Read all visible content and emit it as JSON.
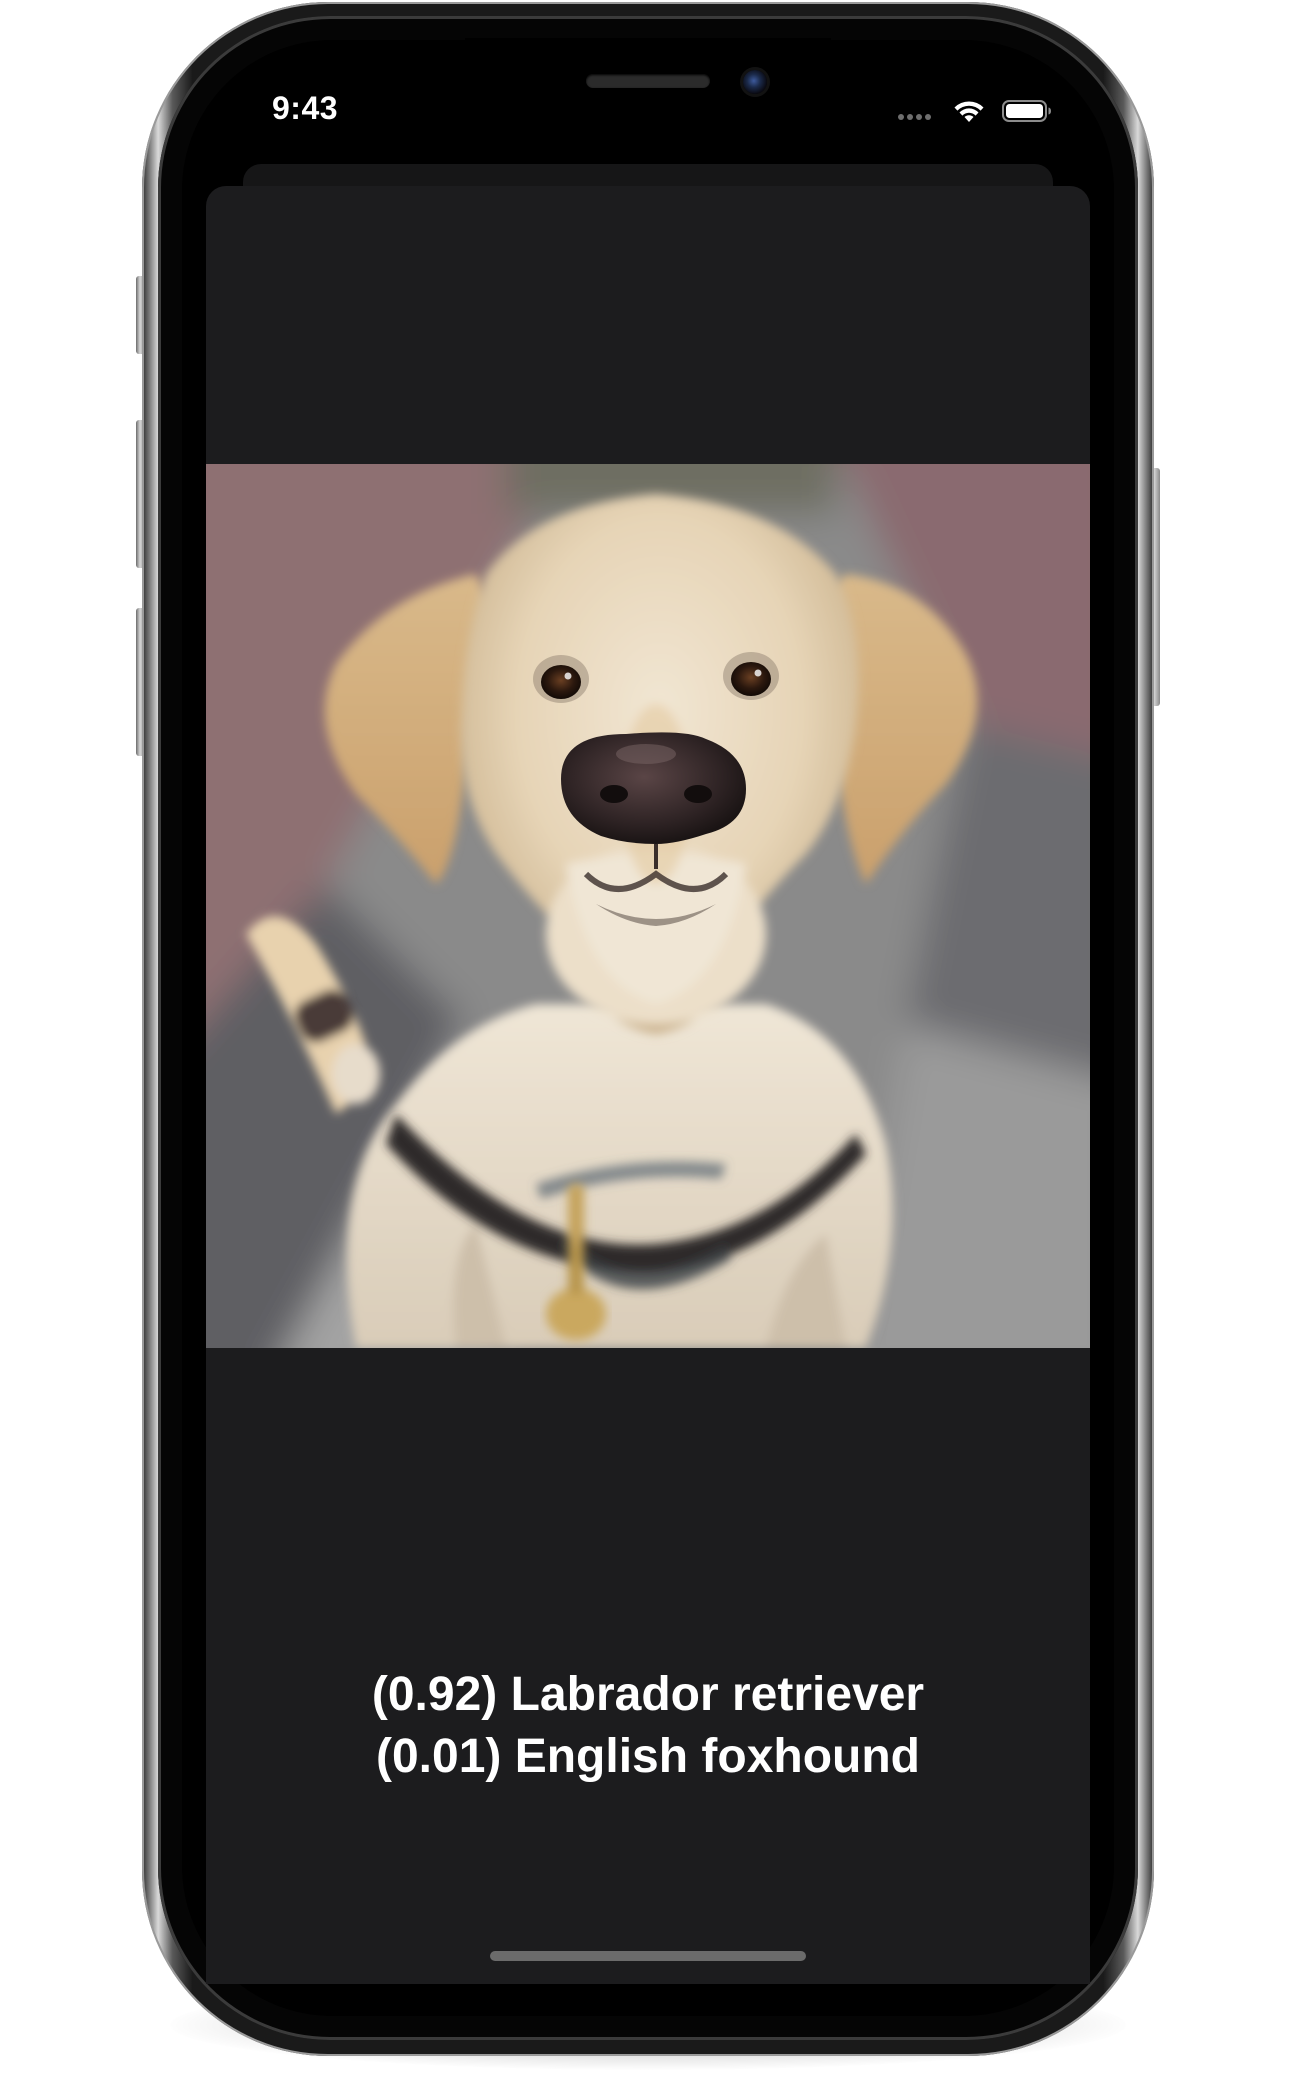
{
  "status_bar": {
    "time": "9:43",
    "signal_icon": "signal-dots-icon",
    "wifi_icon": "wifi-icon",
    "battery_icon": "battery-icon"
  },
  "photo": {
    "subject_icon": "dog-photo"
  },
  "results": {
    "lines": [
      "(0.92) Labrador retriever",
      "(0.01) English foxhound"
    ]
  },
  "colors": {
    "sheet_background": "#1c1c1e",
    "screen_background": "#000000",
    "text": "#ffffff",
    "home_indicator": "#6b6b6b"
  }
}
